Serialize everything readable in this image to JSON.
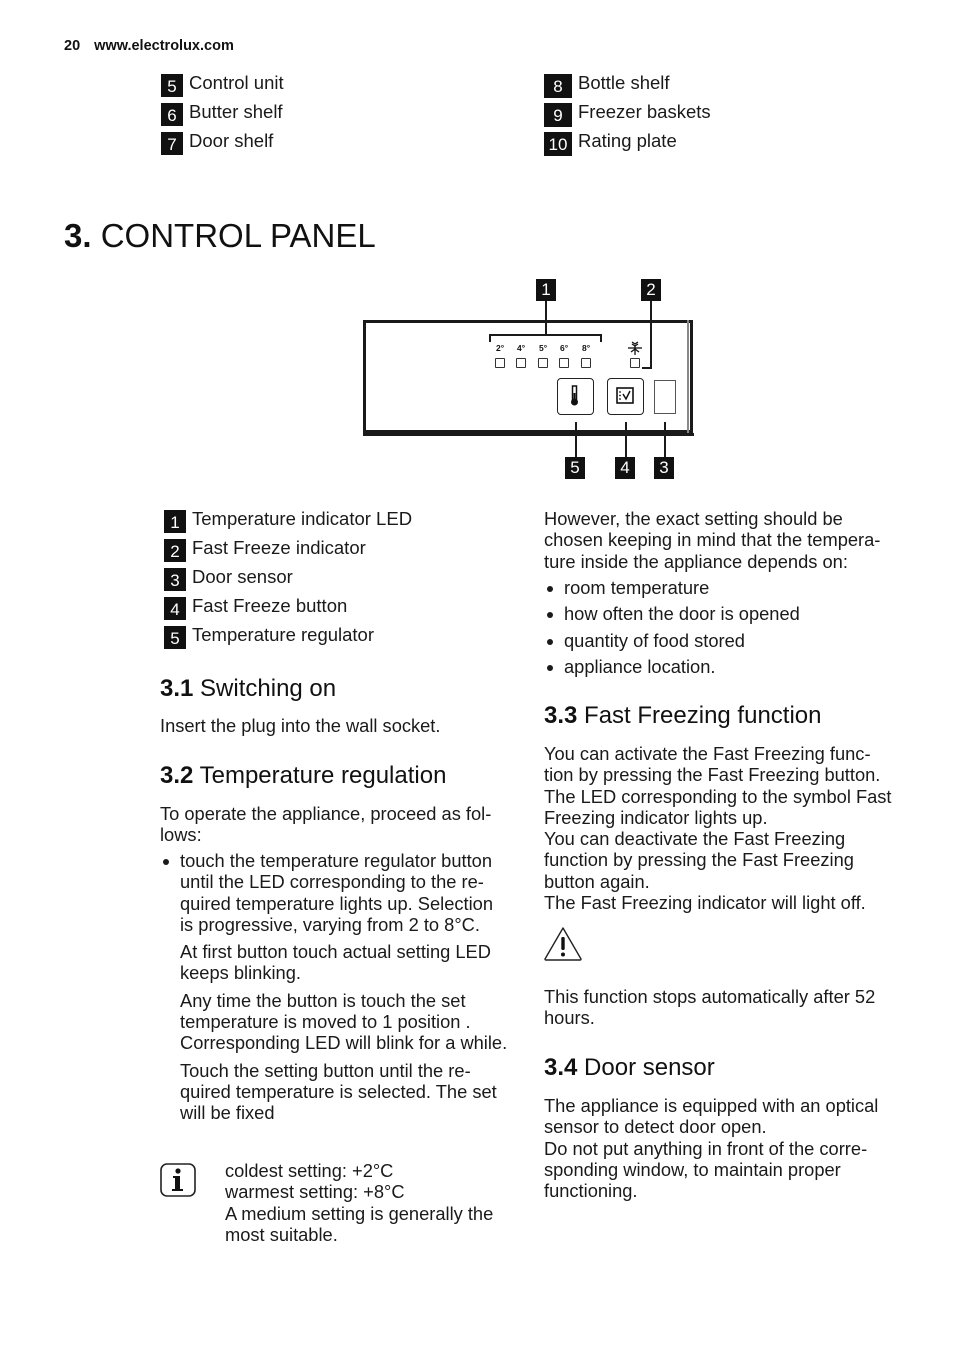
{
  "header": {
    "page_number": "20",
    "website": "www.electrolux.com"
  },
  "parts_legend": {
    "left": [
      {
        "num": "5",
        "label": "Control unit"
      },
      {
        "num": "6",
        "label": "Butter shelf"
      },
      {
        "num": "7",
        "label": "Door shelf"
      }
    ],
    "right": [
      {
        "num": "8",
        "label": "Bottle shelf"
      },
      {
        "num": "9",
        "label": "Freezer baskets"
      },
      {
        "num": "10",
        "label": "Rating plate"
      }
    ]
  },
  "chapter": {
    "number": "3.",
    "title": "CONTROL PANEL"
  },
  "diagram": {
    "callouts": [
      "1",
      "2",
      "3",
      "4",
      "5"
    ],
    "led_labels": [
      "2°",
      "4°",
      "5°",
      "6°",
      "8°"
    ],
    "icons": {
      "fast_freeze_symbol": "snowflake-arrows-icon",
      "temperature_button": "thermometer-icon",
      "fast_freeze_button": "checklist-icon",
      "door_sensor": "sensor-window"
    }
  },
  "control_legend": [
    {
      "num": "1",
      "label": "Temperature indicator LED"
    },
    {
      "num": "2",
      "label": "Fast Freeze indicator"
    },
    {
      "num": "3",
      "label": "Door sensor"
    },
    {
      "num": "4",
      "label": "Fast Freeze button"
    },
    {
      "num": "5",
      "label": "Temperature regulator"
    }
  ],
  "sections": {
    "s3_1": {
      "number": "3.1",
      "title": "Switching on",
      "text": "Insert the plug into the wall socket."
    },
    "s3_2": {
      "number": "3.2",
      "title": "Temperature regulation",
      "intro": "To operate the appliance, proceed as fol-lows:",
      "bullet": "touch the temperature regulator button until the LED corresponding to the re-quired temperature lights up. Selection is progressive, varying from 2 to 8°C.",
      "para1": "At first button touch actual setting LED keeps blinking.",
      "para2": "Any time the button is touch the set temperature is moved to 1 position . Corresponding LED will blink for a while.",
      "para3": "Touch the setting button until the re-quired temperature is selected. The set will be fixed",
      "info_lines": [
        "coldest setting: +2°C",
        "warmest setting: +8°C",
        "A medium setting is generally the most suitable."
      ]
    },
    "right_intro": {
      "text": "However, the exact setting should be chosen keeping in mind that the tempera-ture inside the appliance depends on:",
      "bullets": [
        "room temperature",
        "how often the door is opened",
        "quantity of food stored",
        "appliance location."
      ]
    },
    "s3_3": {
      "number": "3.3",
      "title": "Fast Freezing function",
      "lines": [
        "You can activate the Fast Freezing func-tion by pressing the Fast Freezing button.",
        "The LED corresponding to the symbol Fast Freezing indicator lights up.",
        "You can deactivate the Fast Freezing function by pressing the Fast Freezing button again.",
        "The Fast Freezing indicator will light off."
      ],
      "warning": "This function stops automatically after 52 hours."
    },
    "s3_4": {
      "number": "3.4",
      "title": "Door sensor",
      "lines": [
        "The appliance is equipped with an optical sensor to detect door open.",
        "Do not put anything in front of the corre-sponding window, to maintain proper functioning."
      ]
    }
  }
}
